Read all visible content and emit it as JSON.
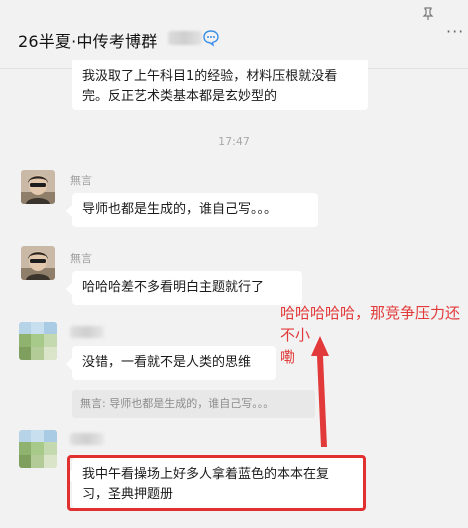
{
  "header": {
    "title": "26半夏·中传考博群",
    "pin_icon": "pin-icon",
    "more_icon": "more-icon",
    "verified_icon": "chat-bubble-badge-icon"
  },
  "messages": {
    "m1": {
      "text_line1": "我汲取了上午科目1的经验，材料压根就没看",
      "text_line2": "完。反正艺术类基本都是玄妙型的"
    },
    "timestamp": "17:47",
    "m2": {
      "sender": "無言",
      "text": "导师也都是生成的，谁自己写。。。"
    },
    "m3": {
      "sender": "無言",
      "text": "哈哈哈差不多看明白主题就行了"
    },
    "m4": {
      "text": "没错，一看就不是人类的思维",
      "quote": "無言: 导师也都是生成的，谁自己写。。。"
    },
    "m5": {
      "text_line1": "我中午看操场上好多人拿着蓝色的本本在复",
      "text_line2": "习，圣典押题册"
    }
  },
  "annotation": {
    "line1": "哈哈哈哈哈，那竞争压力还不小",
    "line2": "嘞",
    "color": "#e23a3a"
  }
}
